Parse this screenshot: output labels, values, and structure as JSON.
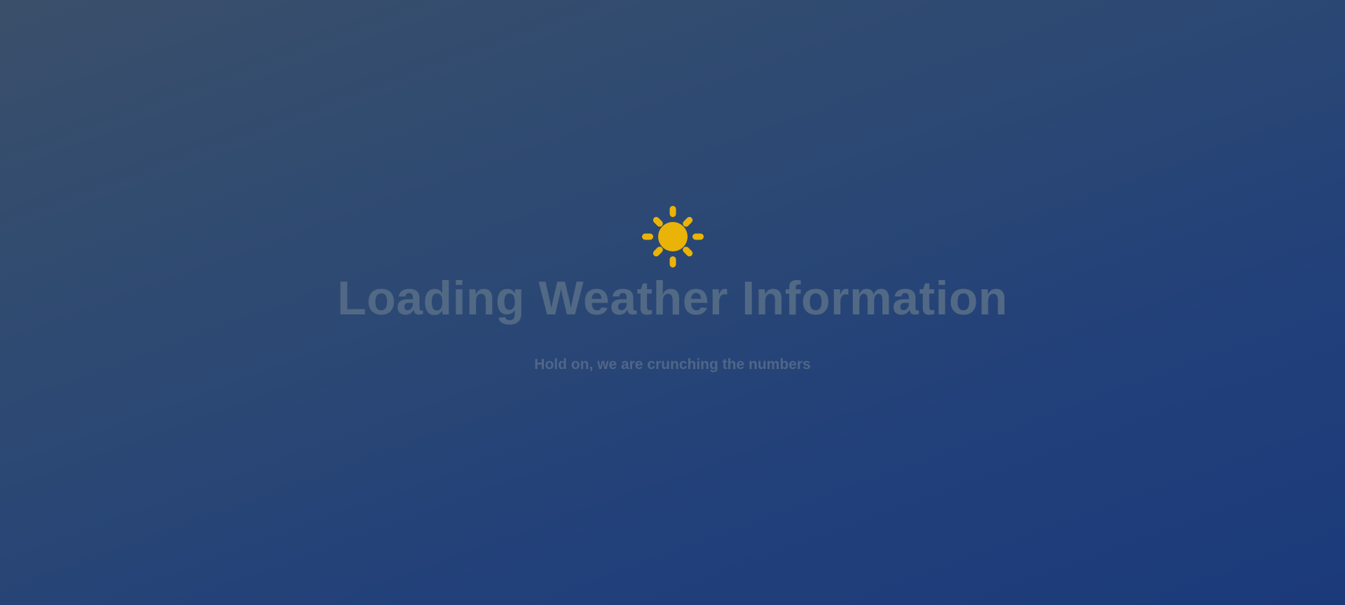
{
  "loading": {
    "icon": "sun-icon",
    "title": "Loading Weather Information",
    "subtitle": "Hold on, we are crunching the numbers"
  },
  "colors": {
    "sun": "#eab308",
    "title": "#526985",
    "subtitle": "#4f6687",
    "background_start": "#3a4f6a",
    "background_end": "#1b3a7a"
  }
}
